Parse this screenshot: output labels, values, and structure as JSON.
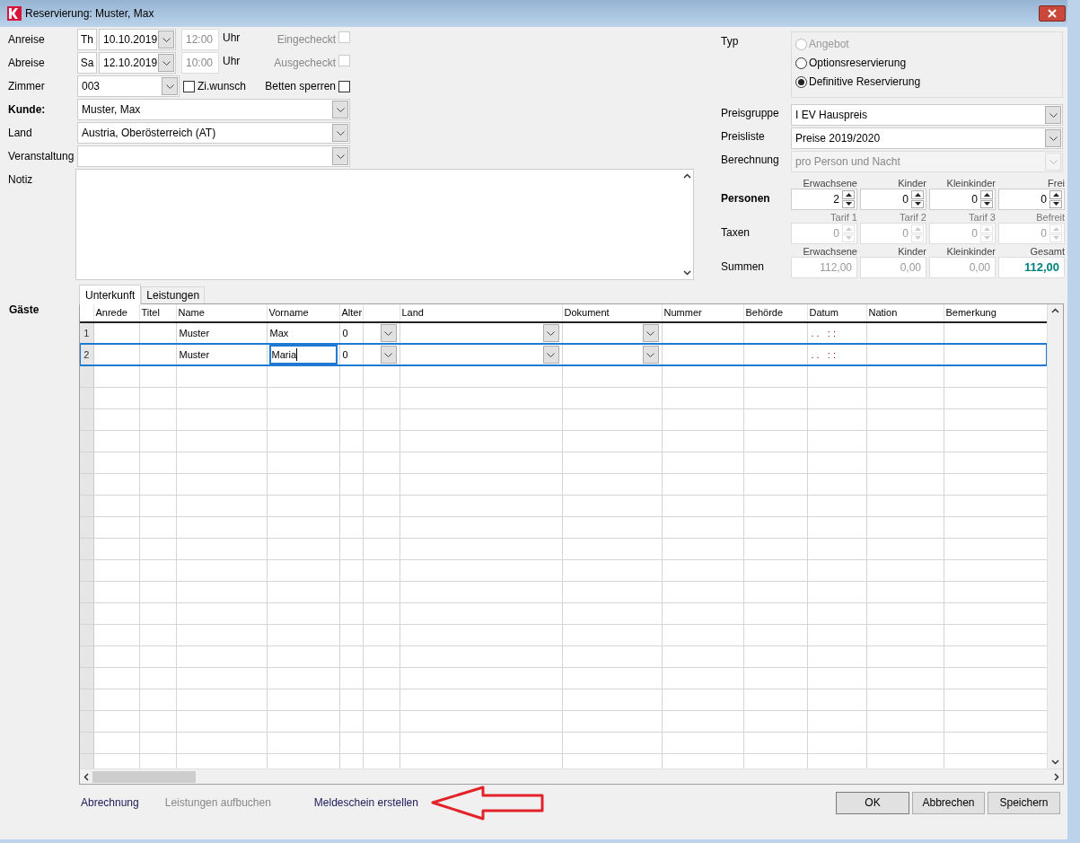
{
  "window": {
    "title": "Reservierung: Muster, Max"
  },
  "stay": [
    {
      "label": "Anreise",
      "weekday": "Th",
      "date": "10.10.2019",
      "time": "12:00",
      "time_unit": "Uhr",
      "check_label": "Eingecheckt",
      "checked": false
    },
    {
      "label": "Abreise",
      "weekday": "Sa",
      "date": "12.10.2019",
      "time": "10:00",
      "time_unit": "Uhr",
      "check_label": "Ausgecheckt",
      "checked": false
    }
  ],
  "room": {
    "label": "Zimmer",
    "value": "003",
    "options": [
      {
        "label": "Zi.wunsch",
        "checked": false
      },
      {
        "label": "Betten sperren",
        "checked": false
      }
    ]
  },
  "fields": [
    {
      "label": "Kunde:",
      "value": "Muster, Max",
      "bold": true
    },
    {
      "label": "Land",
      "value": "Austria, Oberösterreich (AT)",
      "bold": false
    },
    {
      "label": "Veranstaltung",
      "bold": false
    }
  ],
  "note": {
    "label": "Notiz"
  },
  "type": {
    "label": "Typ",
    "options": [
      {
        "label": "Angebot",
        "selected": false,
        "disabled": true
      },
      {
        "label": "Optionsreservierung",
        "selected": false,
        "disabled": false
      },
      {
        "label": "Definitive Reservierung",
        "selected": true,
        "disabled": false
      }
    ]
  },
  "price_fields": [
    {
      "label": "Preisgruppe",
      "value": "I EV Hauspreis",
      "disabled": false
    },
    {
      "label": "Preisliste",
      "value": "Preise 2019/2020",
      "disabled": false
    },
    {
      "label": "Berechnung",
      "value": "pro Person und Nacht",
      "disabled": true
    }
  ],
  "counts": [
    {
      "label": "Personen",
      "bold": true,
      "kind": "spinner",
      "disabled": false,
      "columns": [
        {
          "heading": "Erwachsene",
          "value": "2"
        },
        {
          "heading": "Kinder",
          "value": "0"
        },
        {
          "heading": "Kleinkinder",
          "value": "0"
        },
        {
          "heading": "Frei",
          "value": "0"
        }
      ]
    },
    {
      "label": "Taxen",
      "bold": false,
      "kind": "spinner",
      "disabled": true,
      "columns": [
        {
          "heading": "Tarif 1",
          "value": "0"
        },
        {
          "heading": "Tarif 2",
          "value": "0"
        },
        {
          "heading": "Tarif 3",
          "value": "0"
        },
        {
          "heading": "Befreit",
          "value": "0"
        }
      ]
    },
    {
      "label": "Summen",
      "bold": false,
      "kind": "sum",
      "columns": [
        {
          "heading": "Erwachsene",
          "value": "112,00",
          "total": false
        },
        {
          "heading": "Kinder",
          "value": "0,00",
          "total": false
        },
        {
          "heading": "Kleinkinder",
          "value": "0,00",
          "total": false
        },
        {
          "heading": "Gesamt",
          "value": "112,00",
          "total": true
        }
      ]
    }
  ],
  "guests_label": "Gäste",
  "tabs": [
    {
      "label": "Unterkunft",
      "selected": true
    },
    {
      "label": "Leistungen",
      "selected": false
    }
  ],
  "table": {
    "columns": [
      {
        "heading": "Anrede",
        "kind": "text"
      },
      {
        "heading": "Titel",
        "kind": "text"
      },
      {
        "heading": "Name",
        "kind": "text"
      },
      {
        "heading": "Vorname",
        "kind": "text"
      },
      {
        "heading": "Alter",
        "kind": "text"
      },
      {
        "kind": "combo"
      },
      {
        "heading": "Land",
        "kind": "combo"
      },
      {
        "heading": "Dokument",
        "kind": "combo"
      },
      {
        "heading": "Nummer",
        "kind": "text"
      },
      {
        "heading": "Behörde",
        "kind": "text"
      },
      {
        "heading": "Datum",
        "kind": "date"
      },
      {
        "heading": "Nation",
        "kind": "text"
      },
      {
        "heading": "Bemerkung",
        "kind": "text"
      }
    ],
    "rows": [
      {
        "number": "1",
        "selected": false,
        "cells": [
          "",
          "",
          "Muster",
          "Max",
          "0",
          "",
          "",
          "",
          "",
          "",
          ". .   : :",
          "",
          ""
        ]
      },
      {
        "number": "2",
        "selected": true,
        "cells": [
          "",
          "",
          "Muster",
          "Maria",
          "0",
          "",
          "",
          "",
          "",
          "",
          ". .   : :",
          "",
          ""
        ]
      }
    ]
  },
  "footer_links": [
    {
      "label": "Abrechnung",
      "disabled": false
    },
    {
      "label": "Leistungen aufbuchen",
      "disabled": true
    },
    {
      "label": "Meldeschein erstellen",
      "disabled": false
    }
  ],
  "buttons": [
    {
      "label": "OK",
      "default": true
    },
    {
      "label": "Abbrechen",
      "default": false
    },
    {
      "label": "Speichern",
      "default": false
    }
  ]
}
